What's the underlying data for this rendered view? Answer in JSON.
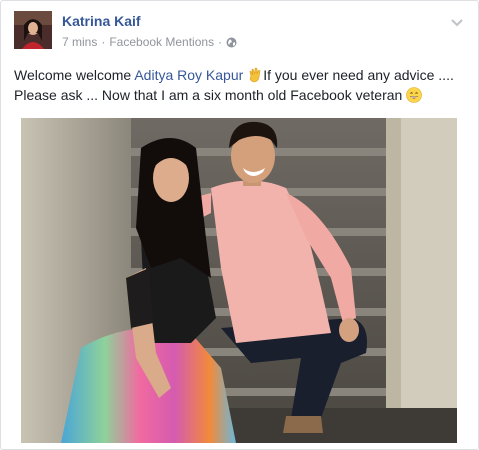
{
  "post": {
    "author": "Katrina Kaif",
    "time": "7 mins",
    "separator": "·",
    "source": "Facebook Mentions",
    "text_before": "Welcome welcome ",
    "mention": "Aditya Roy Kapur",
    "text_after": "If you ever need any advice .... Please ask ... Now that I am a six month old Facebook veteran",
    "icons": {
      "privacy": "globe-icon",
      "menu": "chevron-down-icon",
      "emoji1": "waving-hand-icon",
      "emoji2": "smiling-face-icon"
    }
  },
  "colors": {
    "link": "#365899",
    "meta": "#90949c",
    "text": "#1d2129",
    "border": "#dddfe2"
  }
}
